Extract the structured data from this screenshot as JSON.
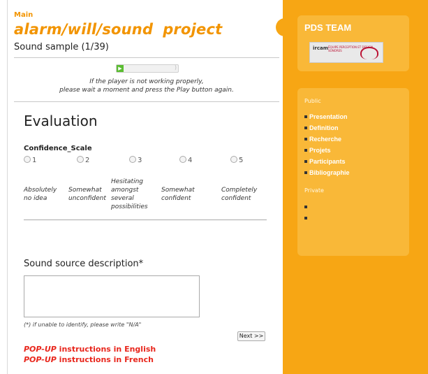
{
  "breadcrumb": "Main",
  "title_part1": "alarm/will/sound",
  "title_part2": "project",
  "sound_sample": "Sound sample (1/39)",
  "player_note_line1": "If the player is not working properly,",
  "player_note_line2": "please wait a moment and press the Play button again.",
  "evaluation_heading": "Evaluation",
  "scale_label": "Confidence_Scale",
  "options": [
    "1",
    "2",
    "3",
    "4",
    "5"
  ],
  "option_labels": [
    [
      "Absolutely",
      "no idea"
    ],
    [
      "Somewhat",
      "unconfident"
    ],
    [
      "Hesitating",
      "amongst",
      "several",
      "possibilities"
    ],
    [
      "Somewhat",
      "confident"
    ],
    [
      "Completely",
      "confident"
    ]
  ],
  "source_heading": "Sound source description*",
  "source_value": "",
  "hint": "(*) if unable to identify, please write \"N/A\"",
  "next_label": "Next >>",
  "popup_en_prefix": "POP-UP",
  "popup_en_text": " instructions in English",
  "popup_fr_prefix": "POP-UP",
  "popup_fr_text": " instructions in French",
  "sidebar": {
    "team": "PDS TEAM",
    "logo_main": "ircam",
    "logo_sub": "ÉQUIPE PERCEPTION ET DESIGN SONORES",
    "public_label": "Public",
    "public_items": [
      "Presentation",
      "Definition",
      "Recherche",
      "Projets",
      "Participants",
      "Bibliographie"
    ],
    "private_label": "Private"
  },
  "colors": {
    "accent": "#f29400",
    "sidebar": "#f7a614",
    "popup": "#e8261c"
  }
}
